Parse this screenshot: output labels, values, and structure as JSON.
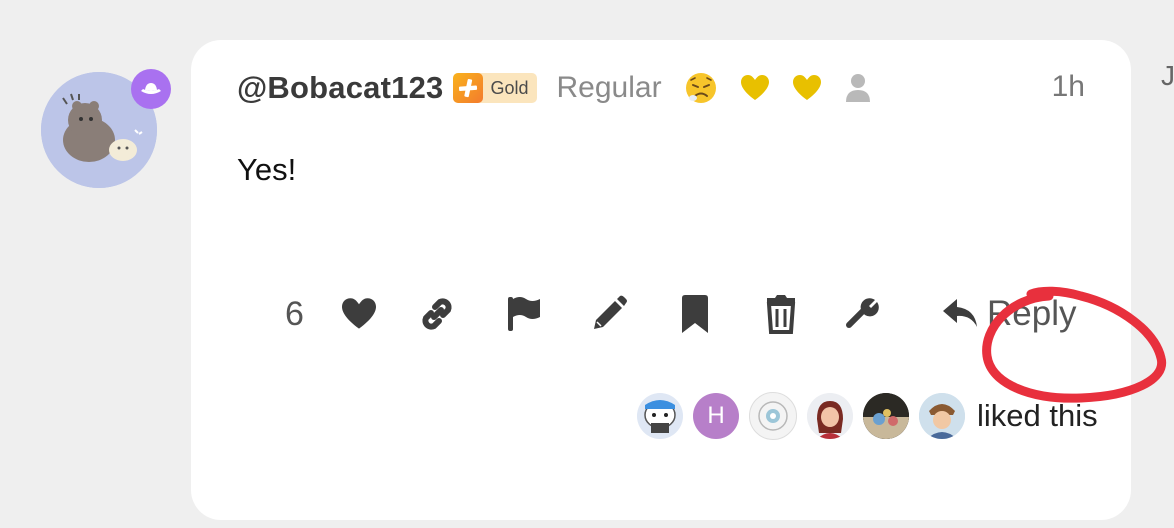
{
  "post": {
    "username": "@Bobacat123",
    "badge_label": "Gold",
    "role": "Regular",
    "time": "1h",
    "body": "Yes!",
    "edge_letter": "J"
  },
  "header_icons": [
    "weary-face-emoji-icon",
    "gold-heart-icon",
    "gold-heart-icon",
    "user-silhouette-icon"
  ],
  "actions": {
    "like_count": "6",
    "reply_label": "Reply",
    "items": [
      "like-heart-icon",
      "link-icon",
      "flag-icon",
      "edit-pencil-icon",
      "bookmark-icon",
      "trash-icon",
      "wrench-icon",
      "reply-arrow-icon"
    ]
  },
  "likers": {
    "initial": "H",
    "label": "liked this"
  },
  "colors": {
    "avatar_bg": "#b9c3e6",
    "avatar_badge": "#a971f0",
    "gold_badge_bg": "#fbe5bd",
    "annotation_circle": "#e8303d",
    "liker_h_bg": "#b77fc9"
  }
}
